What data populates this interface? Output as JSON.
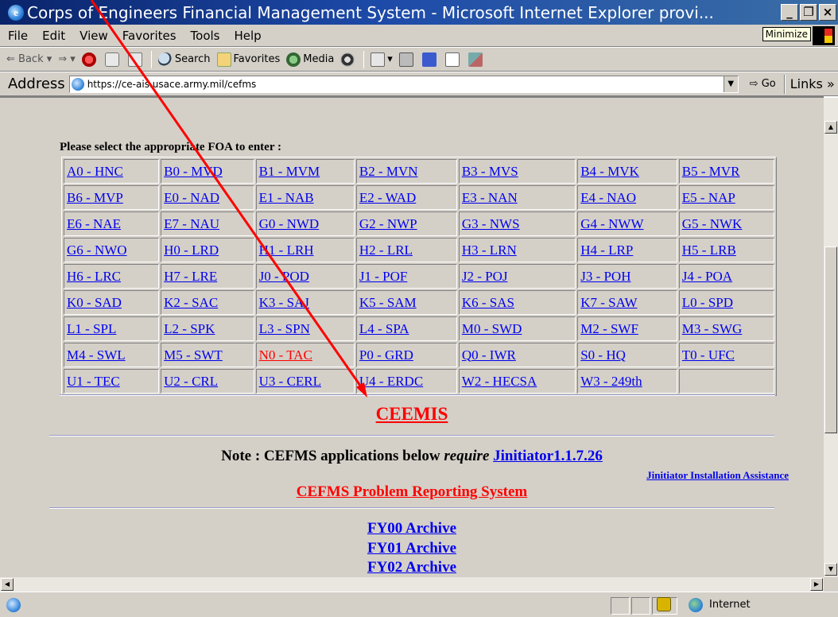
{
  "window": {
    "title": "Corps of Engineers Financial Management System - Microsoft Internet Explorer provi...",
    "minimize_tooltip": "Minimize"
  },
  "menu": [
    "File",
    "Edit",
    "View",
    "Favorites",
    "Tools",
    "Help"
  ],
  "toolbar": {
    "back": "Back",
    "search": "Search",
    "favorites": "Favorites",
    "media": "Media"
  },
  "address": {
    "label": "Address",
    "url": "https://ce-ais.usace.army.mil/cefms",
    "go": "Go",
    "links": "Links"
  },
  "page": {
    "prompt": "Please select the appropriate FOA to enter :",
    "foa_rows": [
      [
        "A0 - HNC",
        "B0 - MVD",
        "B1 - MVM",
        "B2 - MVN",
        "B3 - MVS",
        "B4 - MVK",
        "B5 - MVR"
      ],
      [
        "B6 - MVP",
        "E0 - NAD",
        "E1 - NAB",
        "E2 - WAD",
        "E3 - NAN",
        "E4 - NAO",
        "E5 - NAP"
      ],
      [
        "E6 - NAE",
        "E7 - NAU",
        "G0 - NWD",
        "G2 - NWP",
        "G3 - NWS",
        "G4 - NWW",
        "G5 - NWK"
      ],
      [
        "G6 - NWO",
        "H0 - LRD",
        "H1 - LRH",
        "H2 - LRL",
        "H3 - LRN",
        "H4 - LRP",
        "H5 - LRB"
      ],
      [
        "H6 - LRC",
        "H7 - LRE",
        "J0 - POD",
        "J1 - POF",
        "J2 - POJ",
        "J3 - POH",
        "J4 - POA"
      ],
      [
        "K0 - SAD",
        "K2 - SAC",
        "K3 - SAJ",
        "K5 - SAM",
        "K6 - SAS",
        "K7 - SAW",
        "L0 - SPD"
      ],
      [
        "L1 - SPL",
        "L2 - SPK",
        "L3 - SPN",
        "L4 - SPA",
        "M0 - SWD",
        "M2 - SWF",
        "M3 - SWG"
      ],
      [
        "M4 - SWL",
        "M5 - SWT",
        "N0 - TAC",
        "P0 - GRD",
        "Q0 - IWR",
        "S0 - HQ",
        "T0 - UFC"
      ],
      [
        "U1 - TEC",
        "U2 - CRL",
        "U3 - CERL",
        "U4 - ERDC",
        "W2 - HECSA",
        "W3 - 249th",
        ""
      ]
    ],
    "ceemis": "CEEMIS",
    "note_prefix": "Note : CEFMS applications below ",
    "note_require": "require",
    "note_link": "Jinitiator1.1.7.26",
    "assist_link": "Jinitiator Installation Assistance",
    "problem_link": "CEFMS Problem Reporting System",
    "archives": [
      "FY00 Archive",
      "FY01 Archive",
      "FY02 Archive"
    ]
  },
  "status": {
    "zone": "Internet"
  },
  "colors": {
    "link": "#0000ee",
    "link_red": "#ff0000",
    "chrome": "#d4d0c8",
    "titlebar": "#0a246a",
    "annotation_arrow": "#ff0000"
  }
}
